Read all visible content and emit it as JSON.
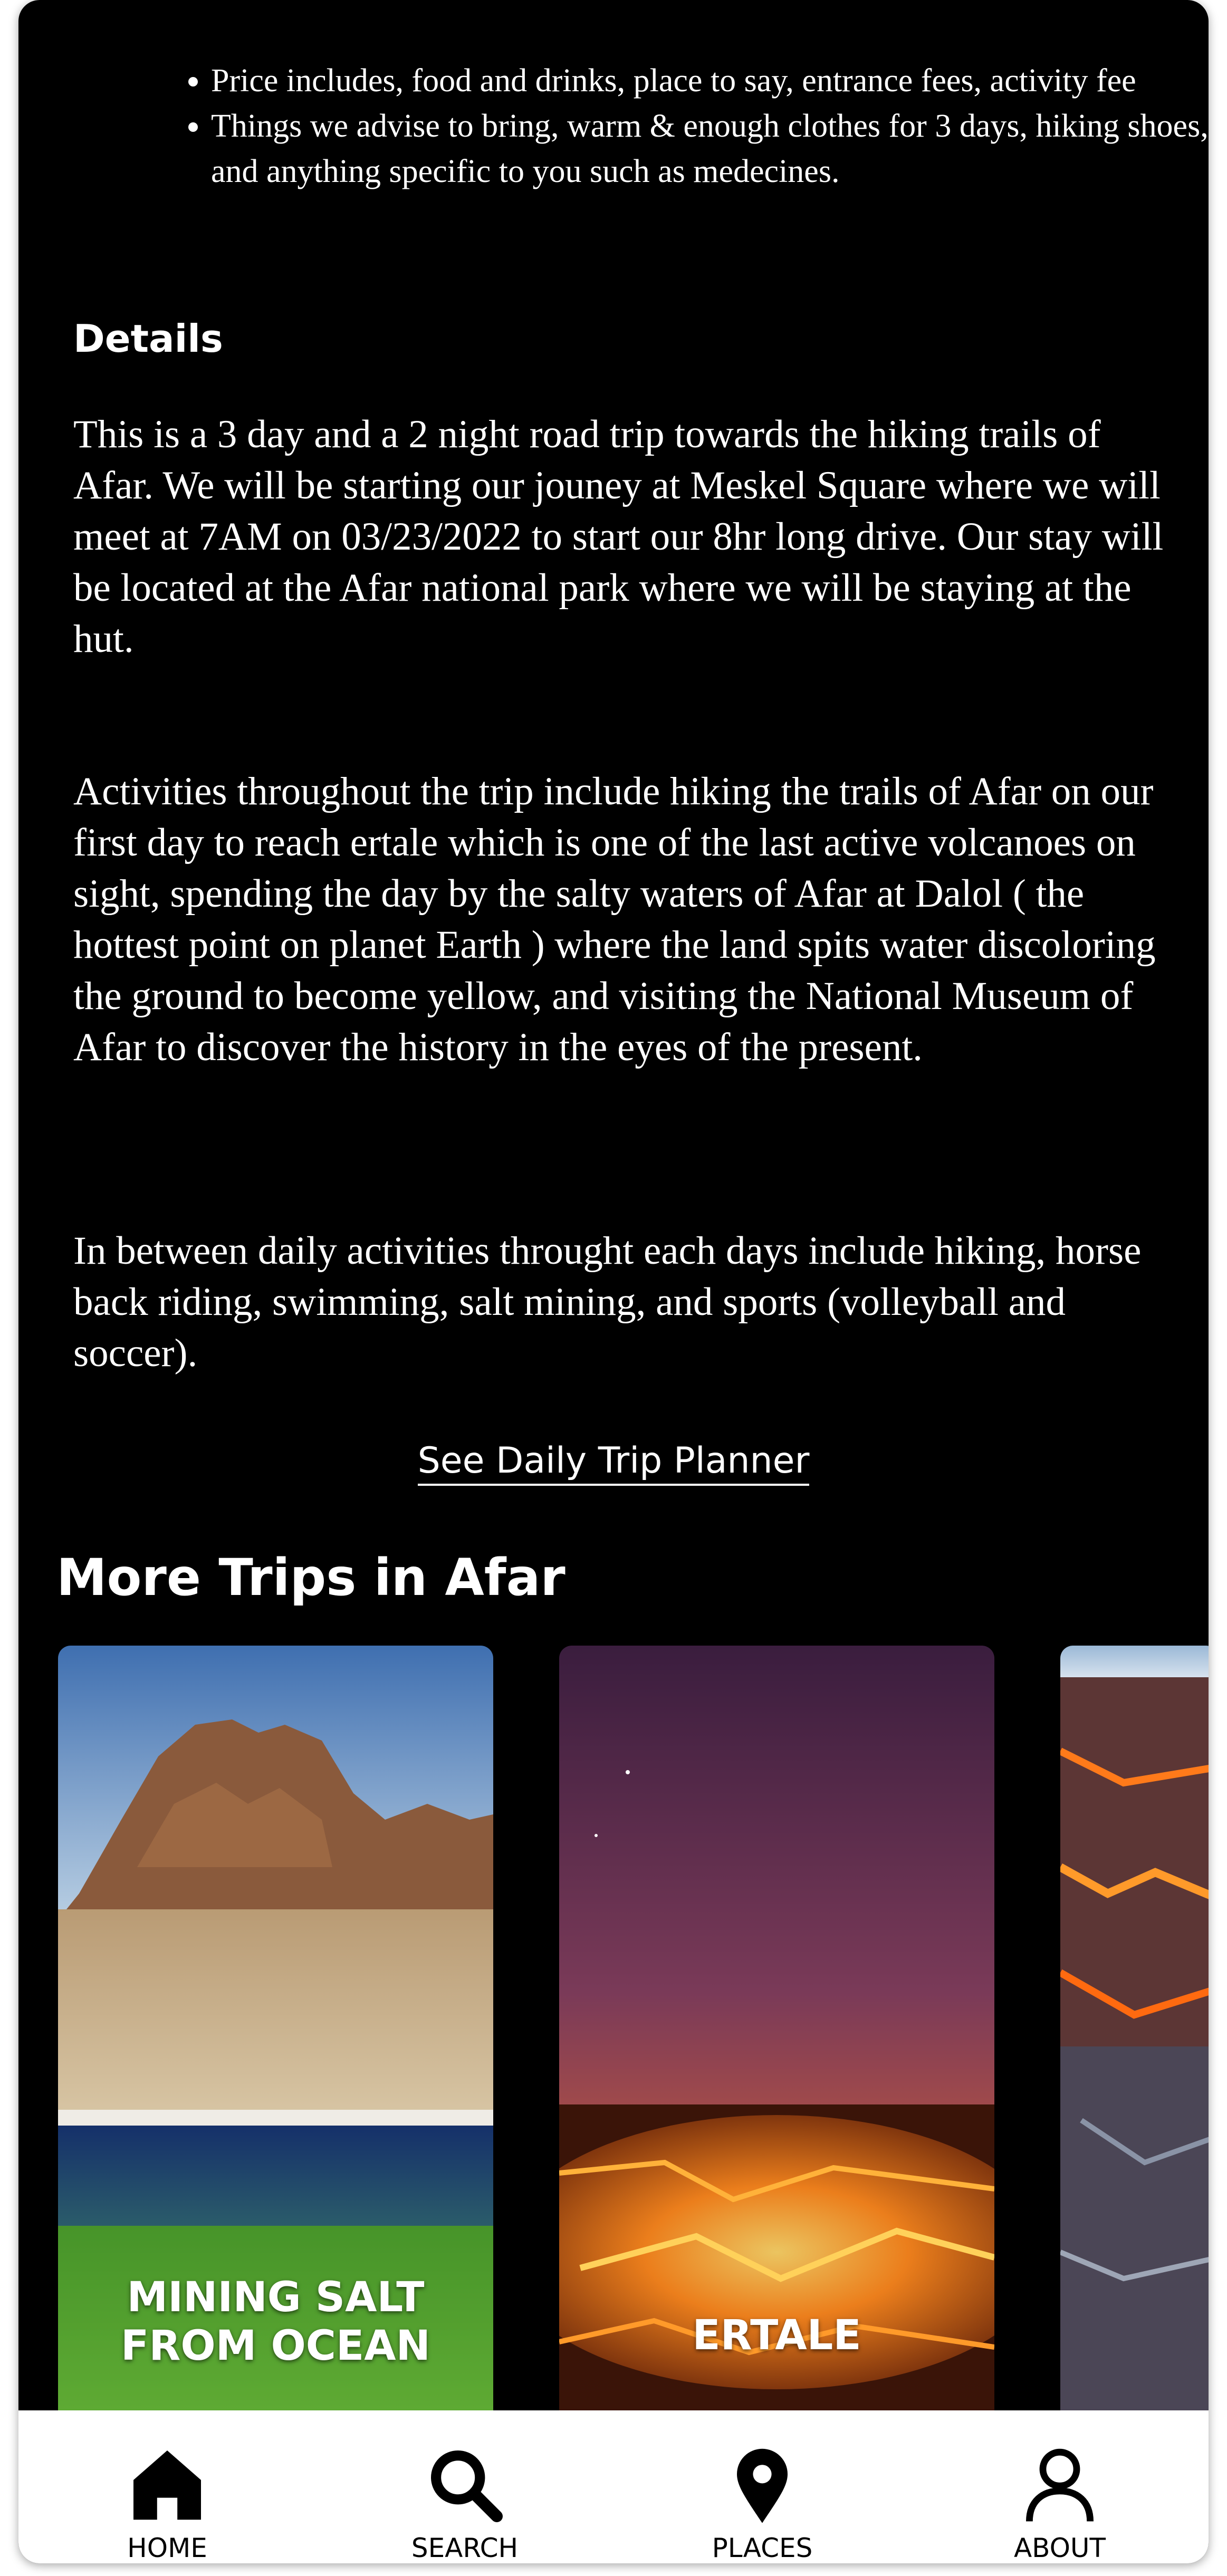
{
  "bullets": [
    "Price includes, food and drinks, place to say, entrance fees, activity fee",
    "Things we advise to bring, warm & enough clothes for 3 days, hiking shoes, and anything specific to you such as medecines."
  ],
  "details": {
    "heading": "Details",
    "paragraphs": [
      "This is a 3 day and a 2 night road trip towards the hiking trails of Afar. We will be starting our jouney at Meskel Square where we will meet at 7AM on 03/23/2022 to start our 8hr long drive. Our stay will be located at the Afar national park where we will be staying at the hut.",
      "Activities throughout the trip include hiking the trails of Afar on our first day to reach ertale which is one of the last active volcanoes on sight, spending the day by the salty waters of Afar at Dalol ( the hottest point on planet Earth ) where the land spits water discoloring the ground to become yellow, and visiting the National Museum of Afar to discover the history in the eyes of the present.",
      "In between daily activities throught each days include hiking, horse back riding, swimming, salt mining, and sports (volleyball and soccer)."
    ],
    "planner_link": "See Daily Trip Planner"
  },
  "more_trips": {
    "heading": "More Trips in Afar",
    "cards": [
      {
        "title_line1": "MINING SALT",
        "title_line2": "FROM OCEAN"
      },
      {
        "title_line1": "ERTALE"
      }
    ]
  },
  "nav": {
    "items": [
      {
        "label": "HOME",
        "icon": "home-icon"
      },
      {
        "label": "SEARCH",
        "icon": "search-icon"
      },
      {
        "label": "PLACES",
        "icon": "location-pin-icon"
      },
      {
        "label": "ABOUT",
        "icon": "person-icon"
      }
    ]
  }
}
